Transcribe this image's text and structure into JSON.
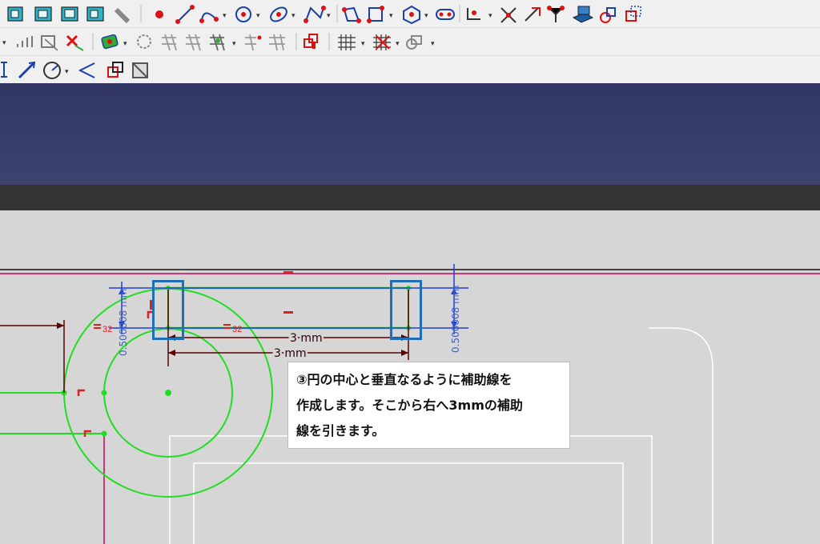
{
  "toolbar": {
    "row1_tools": [
      "view-isometric-icon",
      "view-front-icon",
      "view-top-icon",
      "view-right-icon",
      "measure-icon",
      "sketch-point-icon",
      "sketch-line-icon",
      "sketch-arc-icon",
      "sketch-circle-icon",
      "sketch-ellipse-icon",
      "sketch-bspline-icon",
      "sketch-polyline-icon",
      "sketch-rectangle-icon",
      "sketch-polygon-icon",
      "sketch-slot-icon",
      "sketch-fillet-icon",
      "sketch-trim-icon",
      "sketch-extend-icon",
      "sketch-split-icon",
      "sketch-external-geometry-icon",
      "sketch-carbon-copy-icon",
      "sketch-construction-toggle-icon"
    ],
    "row2_tools": [
      "sketch-array-icon",
      "sketch-clone-icon",
      "sketch-delete-constraints-icon",
      "sketch-show-hide-icon",
      "sketch-symmetry-icon",
      "sketch-move-icon",
      "sketch-rectangular-array-icon",
      "sketch-remove-axes-icon",
      "sketch-delete-geometry-icon",
      "sketch-restore-internal-icon",
      "sketch-switch-virtual-icon",
      "sketch-grid-icon",
      "sketch-snap-icon",
      "sketch-rendering-order-icon"
    ],
    "row3_tools": [
      "constraint-vertical-icon",
      "constraint-distance-icon",
      "constraint-radius-icon",
      "constraint-angle-icon",
      "constraint-driving-toggle-icon",
      "constraint-reference-icon"
    ]
  },
  "sketch": {
    "dim_horizontal_upper": "3 mm",
    "dim_horizontal_lower": "3 mm",
    "dim_vertical_left": "0.500008 mm",
    "dim_vertical_right": "0.500008 mm",
    "equal_marker_left": "32",
    "equal_marker_right": "32"
  },
  "callout": {
    "line1": "③円の中心と垂直なるように補助線を",
    "line2": "作成します。そこから右へ3mmの補助",
    "line3": "線を引きます。"
  },
  "colors": {
    "banner": "#363a67",
    "construction_green": "#22dd22",
    "dimension_maroon": "#5a0000",
    "axis_magenta": "#d33677",
    "highlight_blue": "#1e6fb8",
    "constraint_blue": "#1f3fd6",
    "constraint_red": "#e02020"
  }
}
